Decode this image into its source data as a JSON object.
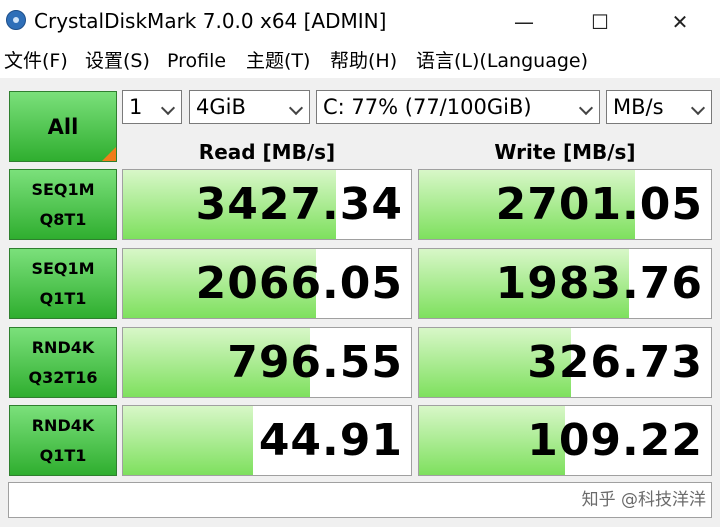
{
  "window": {
    "title": "CrystalDiskMark 7.0.0 x64 [ADMIN]",
    "minimize_glyph": "—",
    "maximize_glyph": "☐",
    "close_glyph": "✕"
  },
  "menu": [
    "文件(F)",
    "设置(S)",
    "Profile",
    "主题(T)",
    "帮助(H)",
    "语言(L)(Language)"
  ],
  "controls": {
    "all_label": "All",
    "count": "1",
    "size": "4GiB",
    "drive": "C: 77% (77/100GiB)",
    "unit": "MB/s"
  },
  "headers": {
    "read": "Read [MB/s]",
    "write": "Write [MB/s]"
  },
  "tests": [
    {
      "line1": "SEQ1M",
      "line2": "Q8T1",
      "read": "3427.34",
      "write": "2701.05",
      "read_fill": 0.74,
      "write_fill": 0.74
    },
    {
      "line1": "SEQ1M",
      "line2": "Q1T1",
      "read": "2066.05",
      "write": "1983.76",
      "read_fill": 0.67,
      "write_fill": 0.72
    },
    {
      "line1": "RND4K",
      "line2": "Q32T16",
      "read": "796.55",
      "write": "326.73",
      "read_fill": 0.65,
      "write_fill": 0.52
    },
    {
      "line1": "RND4K",
      "line2": "Q1T1",
      "read": "44.91",
      "write": "109.22",
      "read_fill": 0.45,
      "write_fill": 0.5
    }
  ],
  "watermark": "知乎 @科技洋洋",
  "colors": {
    "green_fill": "#7ee05e",
    "button_green": "#2fae2f",
    "corner_orange": "#f07d1a"
  }
}
